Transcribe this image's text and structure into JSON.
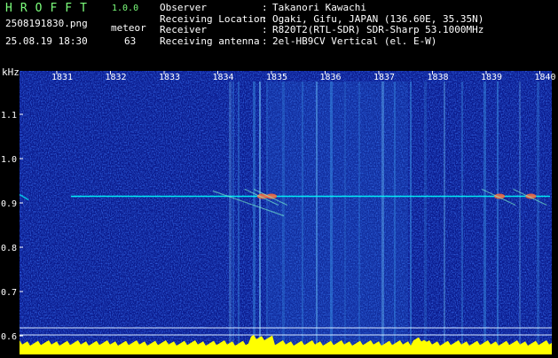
{
  "app": {
    "name": "HROFFT",
    "version": "1.0.0"
  },
  "file": {
    "name": "2508191830.png",
    "datetime": "25.08.19 18:30"
  },
  "meteor": {
    "label": "meteor",
    "count": "63"
  },
  "info": [
    {
      "key": "Observer",
      "value": "Takanori Kawachi"
    },
    {
      "key": "Receiving Location",
      "value": "Ogaki, Gifu, JAPAN (136.60E, 35.35N)"
    },
    {
      "key": "Receiver",
      "value": "R820T2(RTL-SDR) SDR-Sharp 53.1000MHz"
    },
    {
      "key": "Receiving antenna",
      "value": "2el-HB9CV Vertical (el. E-W)"
    }
  ],
  "colors": {
    "header_text": "#7cff7c",
    "background": "#000000",
    "spectrogram_base": "#0a1a8c",
    "signal": "#00ffff",
    "baseline": "#ffff00"
  },
  "chart_data": {
    "type": "heatmap",
    "title": "",
    "xlabel": "",
    "ylabel": "kHz",
    "x_ticks": [
      "1831",
      "1832",
      "1833",
      "1834",
      "1835",
      "1836",
      "1837",
      "1838",
      "1839",
      "1840"
    ],
    "y_ticks": [
      "1.1",
      "1.0",
      "0.9",
      "0.8",
      "0.7",
      "0.6"
    ],
    "ylim": [
      0.6,
      1.15
    ],
    "carrier_khz": 0.915,
    "meteor_echoes": [
      {
        "time": "1834:50",
        "khz": 0.915
      },
      {
        "time": "1835:00",
        "khz": 0.915
      },
      {
        "time": "1839:15",
        "khz": 0.915
      },
      {
        "time": "1839:50",
        "khz": 0.915
      }
    ]
  }
}
